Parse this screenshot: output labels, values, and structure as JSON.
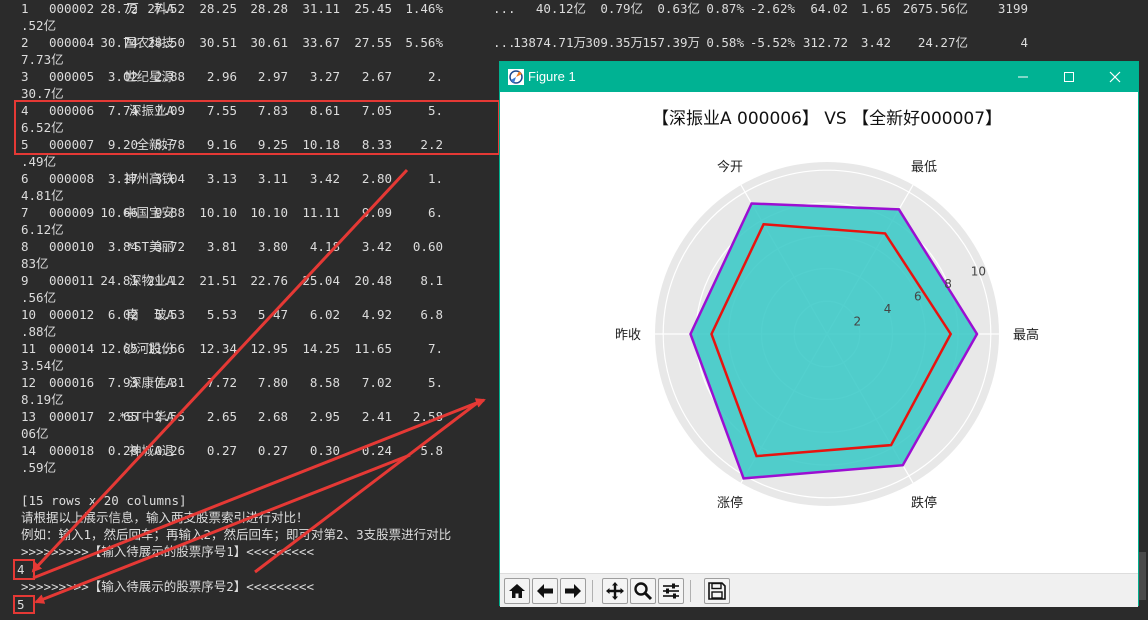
{
  "console": {
    "rows": [
      {
        "idx": "1",
        "code": "000002",
        "name": "万  科A",
        "v": [
          "28.72",
          "27.52",
          "28.25",
          "28.28",
          "31.11",
          "25.45",
          "1.46%",
          "...",
          "40.12亿",
          "0.79亿",
          "0.63亿",
          "0.87%",
          "-2.62%",
          "64.02",
          "1.65",
          "2675.56亿",
          "3199"
        ],
        "wrap": ".52亿"
      },
      {
        "idx": "2",
        "code": "000004",
        "name": "国农科技",
        "v": [
          "30.74",
          "28.50",
          "30.51",
          "30.61",
          "33.67",
          "27.55",
          "5.56%",
          "...",
          "13874.71万",
          "309.35万",
          "157.39万",
          "0.58%",
          "-5.52%",
          "312.72",
          "3.42",
          "24.27亿",
          "4"
        ],
        "wrap": "7.73亿"
      },
      {
        "idx": "3",
        "code": "000005",
        "name": "世纪星源",
        "v": [
          "3.02",
          "2.88",
          "2.96",
          "2.97",
          "3.27",
          "2.67",
          "2."
        ],
        "wrap": "30.7亿"
      },
      {
        "idx": "4",
        "code": "000006",
        "name": "深振业A",
        "v": [
          "7.74",
          "7.09",
          "7.55",
          "7.83",
          "8.61",
          "7.05",
          "5."
        ],
        "wrap": "6.52亿"
      },
      {
        "idx": "5",
        "code": "000007",
        "name": "全新好",
        "v": [
          "9.20",
          "8.78",
          "9.16",
          "9.25",
          "10.18",
          "8.33",
          "2.2"
        ],
        "wrap": ".49亿"
      },
      {
        "idx": "6",
        "code": "000008",
        "name": "神州高铁",
        "v": [
          "3.17",
          "3.04",
          "3.13",
          "3.11",
          "3.42",
          "2.80",
          "1."
        ],
        "wrap": "4.81亿"
      },
      {
        "idx": "7",
        "code": "000009",
        "name": "中国宝安",
        "v": [
          "10.66",
          "9.88",
          "10.10",
          "10.10",
          "11.11",
          "9.09",
          "6."
        ],
        "wrap": "6.12亿"
      },
      {
        "idx": "8",
        "code": "000010",
        "name": "*ST美丽",
        "v": [
          "3.84",
          "3.72",
          "3.81",
          "3.80",
          "4.18",
          "3.42",
          "0.60"
        ],
        "wrap": "83亿"
      },
      {
        "idx": "9",
        "code": "000011",
        "name": "深物业A",
        "v": [
          "24.81",
          "21.12",
          "21.51",
          "22.76",
          "25.04",
          "20.48",
          "8.1"
        ],
        "wrap": ".56亿"
      },
      {
        "idx": "10",
        "code": "000012",
        "name": "南  玻A",
        "v": [
          "6.02",
          "5.53",
          "5.53",
          "5.47",
          "6.02",
          "4.92",
          "6.8"
        ],
        "wrap": ".88亿"
      },
      {
        "idx": "11",
        "code": "000014",
        "name": "沙河股份",
        "v": [
          "12.65",
          "11.66",
          "12.34",
          "12.95",
          "14.25",
          "11.65",
          "7."
        ],
        "wrap": "3.54亿"
      },
      {
        "idx": "12",
        "code": "000016",
        "name": "深康佳A",
        "v": [
          "7.93",
          "7.31",
          "7.72",
          "7.80",
          "8.58",
          "7.02",
          "5."
        ],
        "wrap": "8.19亿"
      },
      {
        "idx": "13",
        "code": "000017",
        "name": "*ST中华A",
        "v": [
          "2.65",
          "2.55",
          "2.65",
          "2.68",
          "2.95",
          "2.41",
          "2.58"
        ],
        "wrap": "06亿"
      },
      {
        "idx": "14",
        "code": "000018",
        "name": "神城A退",
        "v": [
          "0.28",
          "0.26",
          "0.27",
          "0.27",
          "0.30",
          "0.24",
          "5.8"
        ],
        "wrap": ".59亿"
      }
    ],
    "summary": "[15 rows x 20 columns]",
    "prompt_line1": "请根据以上展示信息，输入两支股票索引进行对比！",
    "prompt_line2": "例如：输入1，然后回车；再输入2，然后回车；即可对第2、3支股票进行对比",
    "input_prompt1": ">>>>>>>>>【输入待展示的股票序号1】<<<<<<<<<",
    "input_value1": "4",
    "input_prompt2": ">>>>>>>>>【输入待展示的股票序号2】<<<<<<<<<",
    "input_value2": "5"
  },
  "figure": {
    "window_title": "Figure 1",
    "icons": {
      "app": "matplotlib-icon",
      "minimize": "minimize-icon",
      "maximize": "maximize-icon",
      "close": "close-icon"
    },
    "toolbar": [
      "home-icon",
      "back-arrow-icon",
      "forward-arrow-icon",
      "pan-icon",
      "zoom-icon",
      "configure-subplots-icon",
      "save-icon"
    ]
  },
  "chart_data": {
    "type": "radar",
    "title": "【深振业A 000006】 VS 【全新好000007】",
    "axes": [
      "今开",
      "最低",
      "最高",
      "跌停",
      "涨停",
      "昨收"
    ],
    "radial_ticks": [
      "2",
      "4",
      "6",
      "8",
      "10"
    ],
    "rmax": 10.5,
    "series": [
      {
        "values": [
          7.74,
          7.09,
          7.55,
          7.83,
          8.61,
          7.05
        ],
        "color": "#e8130f"
      },
      {
        "values": [
          9.2,
          8.78,
          9.16,
          9.25,
          10.18,
          8.33
        ],
        "color": "#9b0fd2",
        "fill": "#35c8c6"
      }
    ],
    "grid": true
  },
  "colors": {
    "highlight": "#e53935",
    "arrow": "#e53935",
    "titlebar": "#00b293"
  }
}
